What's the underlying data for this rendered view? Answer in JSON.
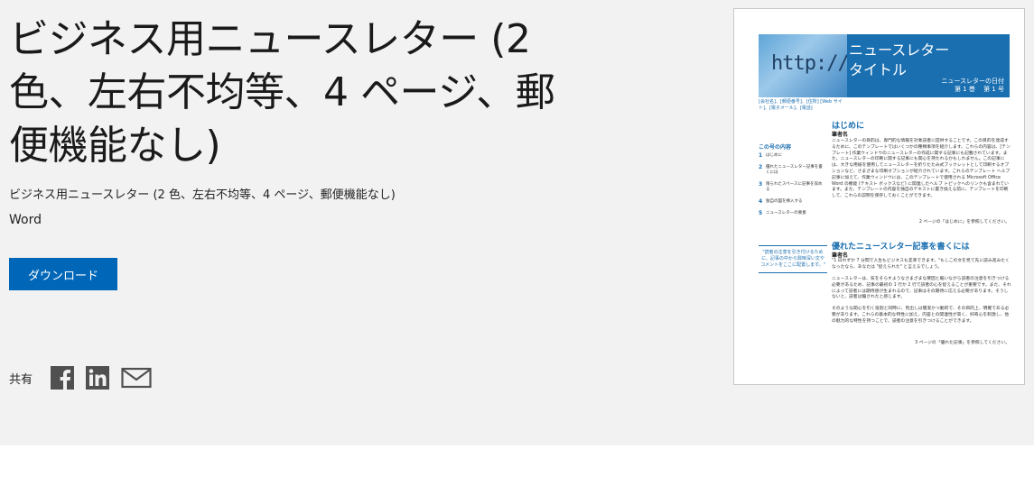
{
  "page": {
    "title": "ビジネス用ニュースレター (2 色、左右不均等、4 ページ、郵便機能なし)",
    "subtitle": "ビジネス用ニュースレター (2 色、左右不均等、4 ページ、郵便機能なし)",
    "app": "Word",
    "download_label": "ダウンロード",
    "share_label": "共有"
  },
  "share_icons": [
    "facebook-icon",
    "linkedin-icon",
    "mail-icon"
  ],
  "colors": {
    "accent": "#0067b8",
    "panel_bg": "#f2f2f2",
    "preview_blue": "#1a6fb0"
  },
  "preview": {
    "banner": {
      "http_text": "http://www",
      "title_line1": "ニュースレター",
      "title_line2": "タイトル",
      "date": "ニュースレターの日付",
      "volume": "第 1 巻　 第 1 号"
    },
    "contact": "[会社名]、[郵便番号]、[住所] [Web サイト]、[電子メール]、[電話]",
    "contents_title": "この号の内容",
    "contents": [
      {
        "num": "1",
        "text": "はじめに"
      },
      {
        "num": "2",
        "text": "優れたニュースレター記事を書くには"
      },
      {
        "num": "3",
        "text": "限られたスペースに記事を収める"
      },
      {
        "num": "4",
        "text": "独自の図を挿入する"
      },
      {
        "num": "5",
        "text": "ニュースレターの要素"
      }
    ],
    "pullquote": "\"読者の注意を引き付けるために、記事の中から興味深い文やコメントをここに配置します。\"",
    "section1": {
      "heading": "はじめに",
      "author": "筆者名",
      "body": "ニュースレターの目的は、専門的な情報を対象読者に提供することです。この目的を達成するために、このテンプレートではいくつかの種類事項を紹介します。これらの内容は、[テンプレート] 作業ウィンドウのニュースレターの作成に関する記事にも記載されています。また、ニュースレターの印刷に関する記事にも関心を持たれるかもしれません。この記事には、大きな用紙を使用してニュースレターを折りたたみ式ブックレットとして印刷するオプションなど、さまざまな印刷オプションが紹介されています。これらのテンプレート ヘルプ記事に加えて、作業ウィンドウには、このテンプレートで使用される Microsoft Office Word の機能 (テキスト ボックスなど) に関連したヘルプ トピックへのリンクも含まれています。また、テンプレートの内容を独自のテキストに置き換える前に、テンプレートを印刷して、これらの説明を保存しておくことができます。",
      "ref": "2 ページの「はじめに」を参照してください。"
    },
    "section2": {
      "heading": "優れたニュースレター記事を書くには",
      "author": "筆者名",
      "body1": "\"1 日わずか 7 分間で人生もビジネスも変革できます。\"もしこの文を見て先に読み進みたくなったなら、あなたは \"捉えられた\" と言えるでしょう。",
      "body2": "ニュースレターは、気をそらすようなさまざまな要因と戦いながら読者の注意を引きつける必要があるため、記事の最初の 1 行か 2 行で読者の心を捉えることが重要です。また、それによって読者には期待感が生まれるので、記事はその期待に応える必要があります。そうしないと、読者は騙されたと感じます。",
      "body3": "そのような関心を引く役割と同時に、見出しは簡潔かつ動的で、その目的上、明確である必要があります。これらの基本的な特性に加え、内容との関連性が高く、好奇心を刺激し、他の魅力的な特性を持つことで、読者の注意を引きつけることができます。",
      "ref": "3 ページの「優れた記事」を参照してください。"
    }
  }
}
